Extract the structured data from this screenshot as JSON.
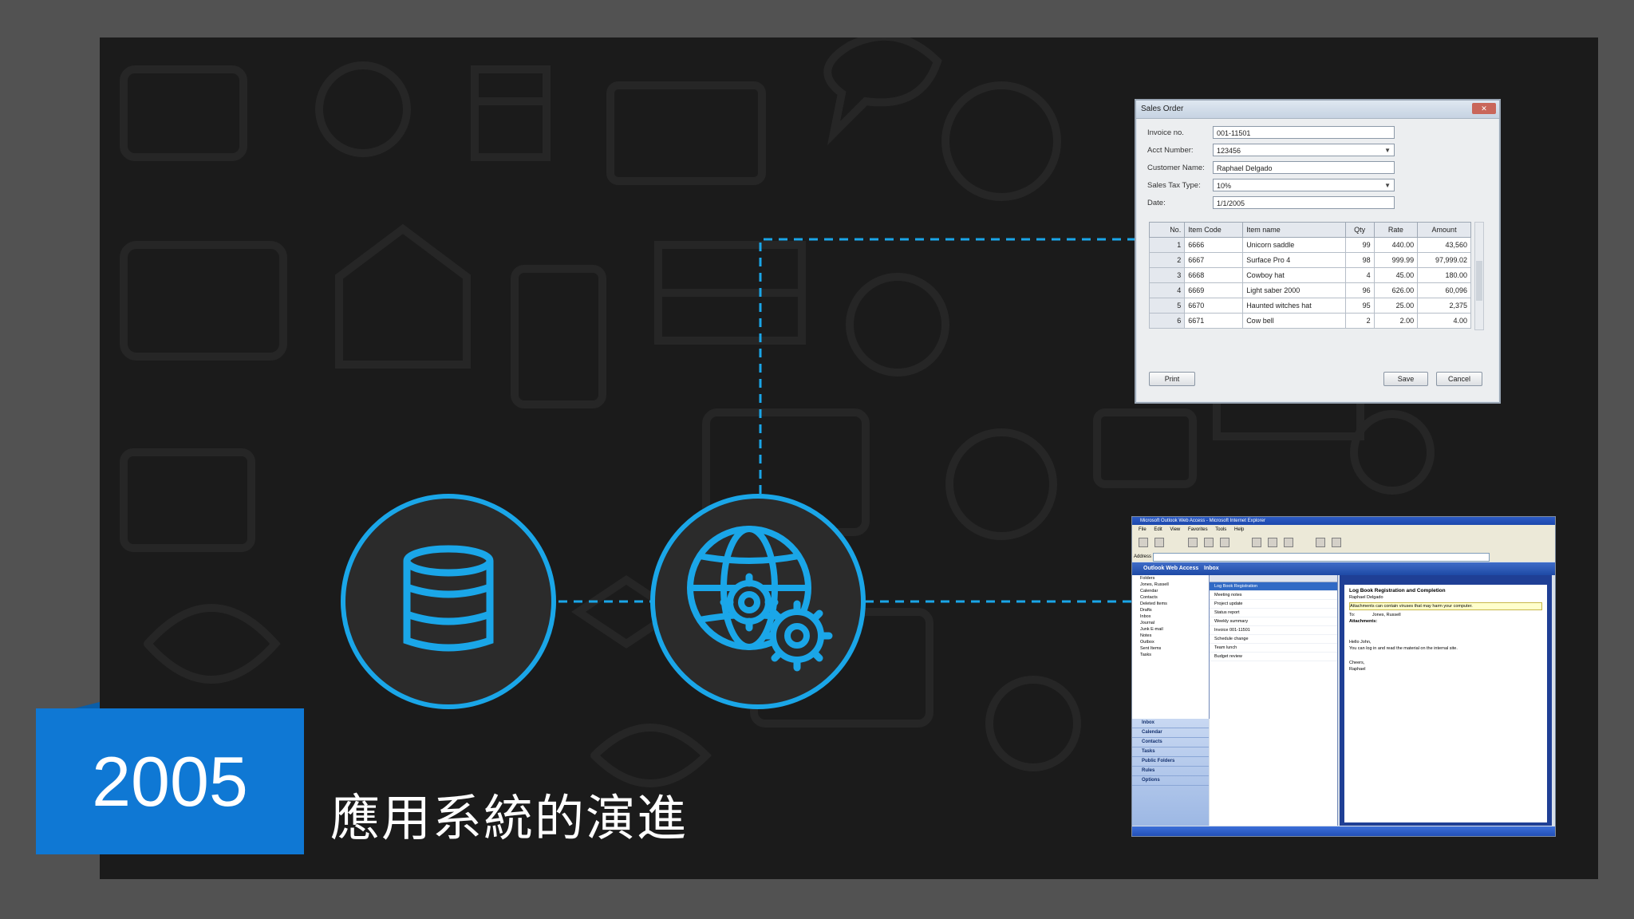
{
  "slide": {
    "year": "2005",
    "title": "應用系統的演進"
  },
  "icons": {
    "node_1": "database-icon",
    "node_2": "globe-gear-icon"
  },
  "colors": {
    "accent": "#1aa6e8",
    "badge": "#0f78d4",
    "slide_bg": "#1b1b1b",
    "frame": "#525252"
  },
  "sales_window": {
    "title": "Sales Order",
    "fields": [
      {
        "label": "Invoice no.",
        "value": "001-11501"
      },
      {
        "label": "Acct Number:",
        "value": "123456"
      },
      {
        "label": "Customer Name:",
        "value": "Raphael Delgado"
      },
      {
        "label": "Sales Tax Type:",
        "value": "10%"
      },
      {
        "label": "Date:",
        "value": "1/1/2005"
      }
    ],
    "columns": [
      "No.",
      "Item Code",
      "Item name",
      "Qty",
      "Rate",
      "Amount"
    ],
    "rows": [
      [
        "1",
        "6666",
        "Unicorn saddle",
        "99",
        "440.00",
        "43,560"
      ],
      [
        "2",
        "6667",
        "Surface Pro 4",
        "98",
        "999.99",
        "97,999.02"
      ],
      [
        "3",
        "6668",
        "Cowboy hat",
        "4",
        "45.00",
        "180.00"
      ],
      [
        "4",
        "6669",
        "Light saber 2000",
        "96",
        "626.00",
        "60,096"
      ],
      [
        "5",
        "6670",
        "Haunted witches hat",
        "95",
        "25.00",
        "2,375"
      ],
      [
        "6",
        "6671",
        "Cow bell",
        "2",
        "2.00",
        "4.00"
      ]
    ],
    "buttons": {
      "print": "Print",
      "save": "Save",
      "cancel": "Cancel"
    }
  },
  "outlook_window": {
    "title": "Microsoft Outlook Web Access - Microsoft Internet Explorer",
    "menu": [
      "File",
      "Edit",
      "View",
      "Favorites",
      "Tools",
      "Help"
    ],
    "address_label": "Address",
    "brand": "Outlook Web Access",
    "inbox_label": "Inbox",
    "folders": [
      "Folders",
      "Jones, Russell",
      "Calendar",
      "Contacts",
      "Deleted Items",
      "Drafts",
      "Inbox",
      "Journal",
      "Junk E-mail",
      "Notes",
      "Outbox",
      "Sent Items",
      "Tasks"
    ],
    "nav": [
      "Inbox",
      "Calendar",
      "Contacts",
      "Tasks",
      "Public Folders",
      "Rules",
      "Options"
    ],
    "messages": [
      "Log Book Registration",
      "Meeting notes",
      "Project update",
      "Status report",
      "Weekly summary",
      "Invoice 001-11501",
      "Schedule change",
      "Team lunch",
      "Budget review"
    ],
    "reading": {
      "subject": "Log Book Registration and Completion",
      "from": "Raphael Delgado",
      "warning": "Attachments can contain viruses that may harm your computer.",
      "to_label": "To:",
      "to": "Jones, Russell",
      "attachments_label": "Attachments:",
      "greeting": "Hello John,",
      "body": "You can log in and read the material on the internal site.",
      "closing": "Cheers,",
      "signature": "Raphael"
    }
  }
}
